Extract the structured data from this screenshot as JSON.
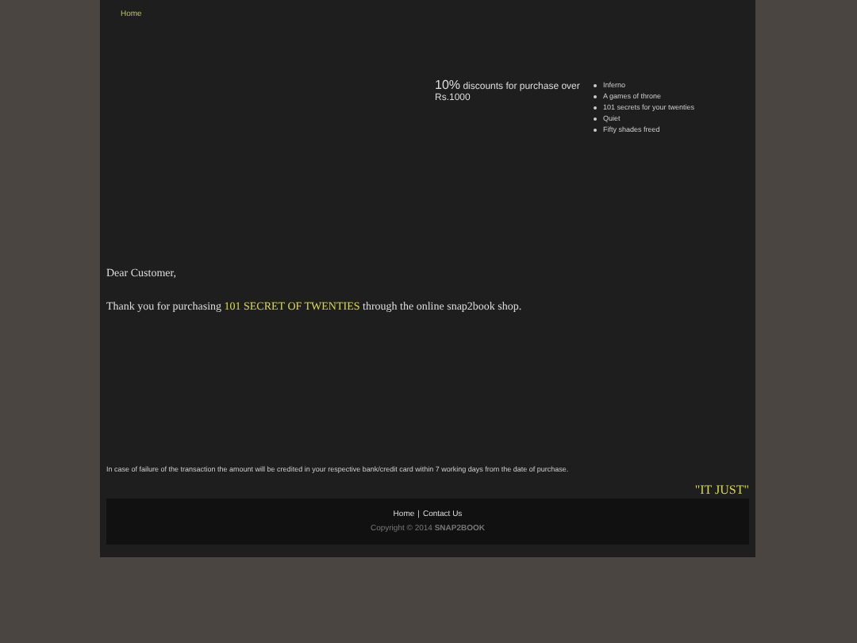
{
  "nav": {
    "links": [
      "Home"
    ]
  },
  "promo": {
    "highlight": "10%",
    "text": "discounts for purchase over Rs.1000"
  },
  "book_list": [
    "Inferno",
    "A games of throne",
    "101 secrets for your twenties",
    "Quiet",
    "Fifty shades freed"
  ],
  "greeting": "Dear Customer,",
  "message": {
    "before": "Thank you for purchasing ",
    "book": "101 SECRET OF TWENTIES",
    "after": " through the online snap2book shop."
  },
  "note": "In case of failure of the transaction the amount will be credited in your respective bank/credit card within 7 working days from the date of purchase.",
  "tagline": "\"IT JUST\"",
  "footer": {
    "links": [
      "Home",
      "Contact Us"
    ],
    "separator": "|",
    "copyright": "Copyright © 2014 **SNAP2BOOK**"
  }
}
